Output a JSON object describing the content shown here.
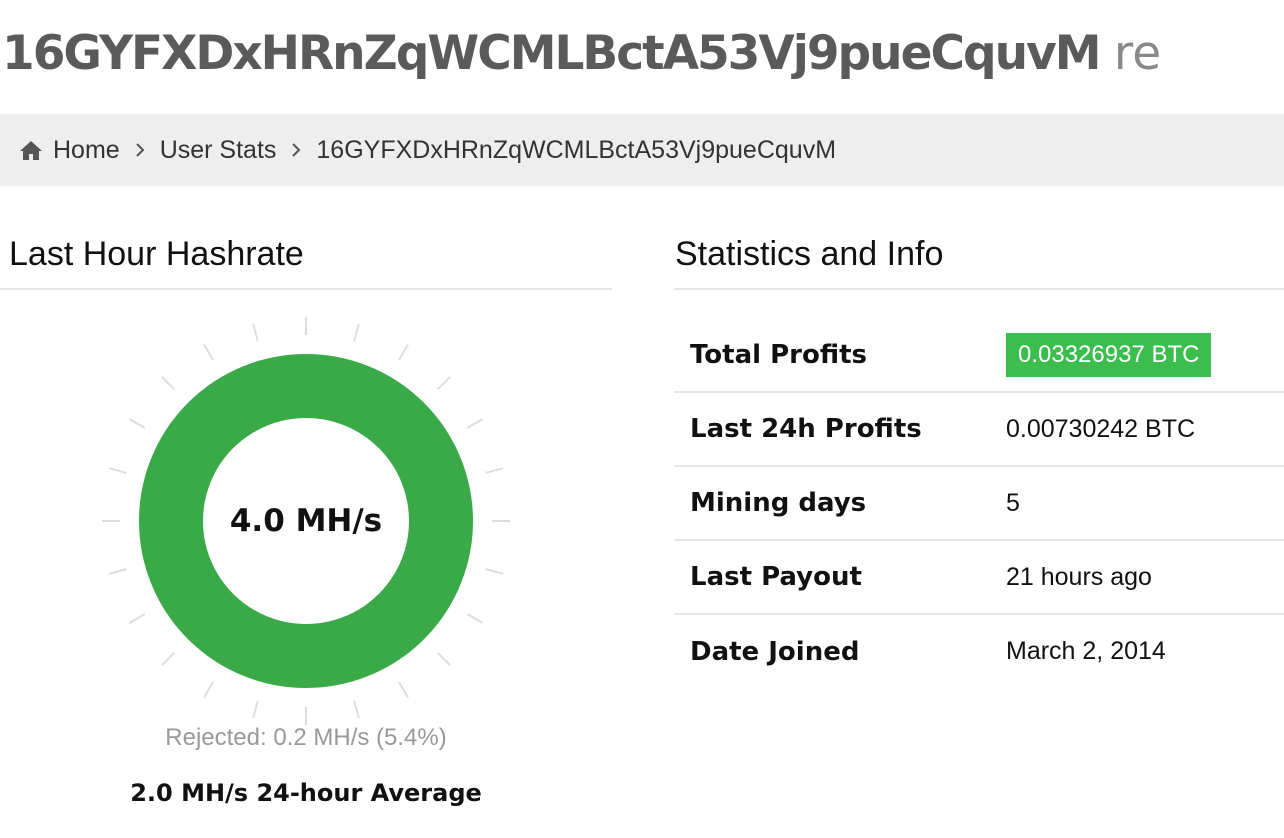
{
  "header": {
    "address": "16GYFXDxHRnZqWCMLBctA53Vj9pueCquvM",
    "suffix": "re"
  },
  "breadcrumb": {
    "home_icon": "home-icon",
    "items": [
      "Home",
      "User Stats",
      "16GYFXDxHRnZqWCMLBctA53Vj9pueCquvM"
    ]
  },
  "hashrate": {
    "heading": "Last Hour Hashrate",
    "value": "4.0 MH/s",
    "gauge_fill": 1.0,
    "color": "#3aaa49",
    "rejected": "Rejected: 0.2 MH/s (5.4%)",
    "average": "2.0 MH/s 24-hour Average"
  },
  "stats": {
    "heading": "Statistics and Info",
    "rows": [
      {
        "label": "Total Profits",
        "value": "0.03326937 BTC",
        "highlight_color": "#3cbe4e"
      },
      {
        "label": "Last 24h Profits",
        "value": "0.00730242 BTC"
      },
      {
        "label": "Mining days",
        "value": "5"
      },
      {
        "label": "Last Payout",
        "value": "21 hours ago"
      },
      {
        "label": "Date Joined",
        "value": "March 2, 2014"
      }
    ]
  }
}
